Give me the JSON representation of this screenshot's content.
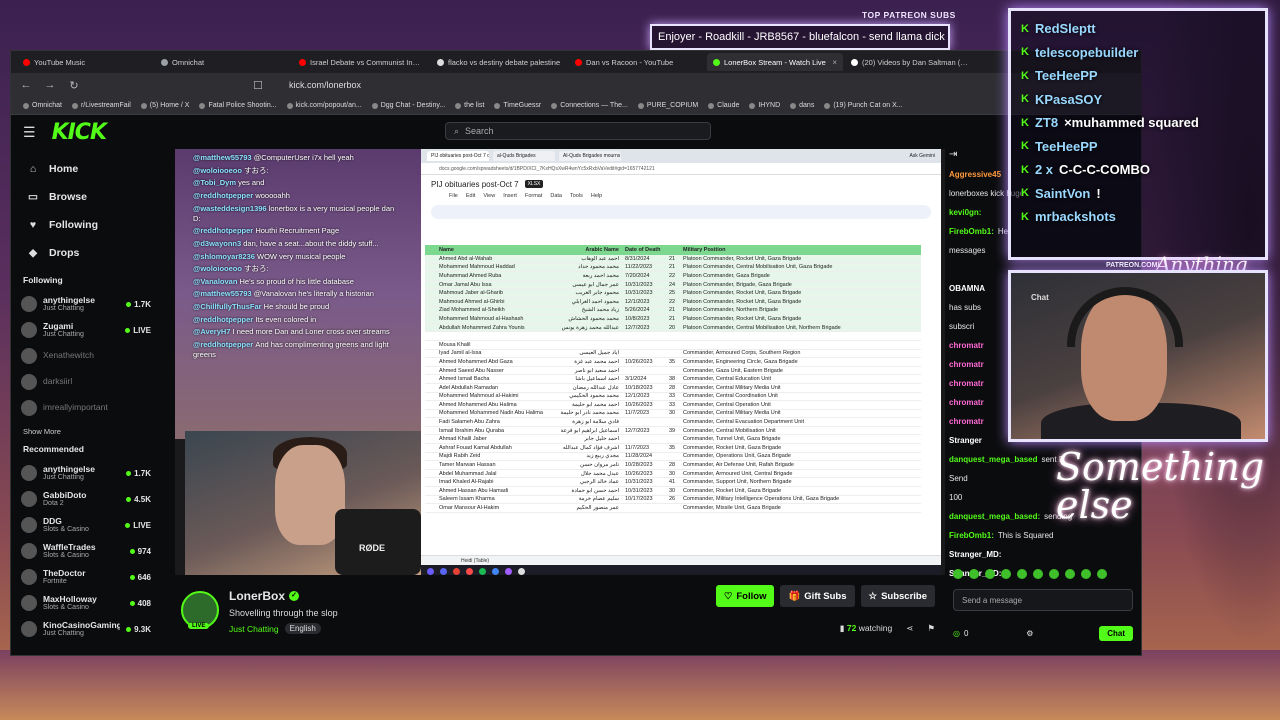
{
  "overlay": {
    "patreon_title": "TOP PATREON SUBS",
    "ticker": "Enjoyer - Roadkill - JRB8567 - bluefalcon - send llama dick",
    "patreon_url": "PATREON.COM/",
    "brand_script": "Something else",
    "brand_script_small": "Anything else",
    "subs": [
      {
        "name": "RedSleptt",
        "suffix": ""
      },
      {
        "name": "telescopebuilder",
        "suffix": ""
      },
      {
        "name": "TeeHeePP",
        "suffix": ""
      },
      {
        "name": "KPasaSOY",
        "suffix": ""
      },
      {
        "name": "ZT8",
        "suffix": "×muhammed squared"
      },
      {
        "name": "TeeHeePP",
        "suffix": ""
      },
      {
        "name": "2 x",
        "suffix": "C-C-C-COMBO"
      },
      {
        "name": "SaintVon",
        "suffix": "!"
      },
      {
        "name": "mrbackshots",
        "suffix": ""
      }
    ],
    "cam_label": "Chat"
  },
  "browser": {
    "tabs": [
      {
        "label": "YouTube Music",
        "color": "#ff0000",
        "active": false
      },
      {
        "label": "Omnichat",
        "color": "#9aa0a6",
        "active": false
      },
      {
        "label": "Israel Debate vs Communist Instant",
        "color": "#ff0000",
        "active": false
      },
      {
        "label": "flacko vs destiny debate palestine",
        "color": "#dddddd",
        "active": false
      },
      {
        "label": "Dan vs Racoon - YouTube",
        "color": "#ff0000",
        "active": false
      },
      {
        "label": "LonerBox Stream - Watch Live",
        "color": "#53fc18",
        "active": true
      },
      {
        "label": "(20) Videos by Dan Saltman (@dan",
        "color": "#ffffff",
        "active": false
      }
    ],
    "url": "kick.com/lonerbox",
    "bookmarks": [
      "Omnichat",
      "r/LivestreamFail",
      "(5) Home / X",
      "Fatal Police Shootin...",
      "kick.com/popout/an...",
      "Dgg Chat - Destiny...",
      "the list",
      "TimeGuessr",
      "Connections — The...",
      "PURE_COPIUM",
      "Claude",
      "IHYND",
      "dans",
      "(19) Punch Cat on X..."
    ]
  },
  "kick": {
    "search_placeholder": "Search",
    "nav": [
      {
        "label": "Home",
        "icon": "⌂"
      },
      {
        "label": "Browse",
        "icon": "▭"
      },
      {
        "label": "Following",
        "icon": "♥"
      },
      {
        "label": "Drops",
        "icon": "◆"
      }
    ],
    "following_header": "Following",
    "following": [
      {
        "name": "anythingelse",
        "cat": "Just Chatting",
        "viewers": "1.7K",
        "dim": false
      },
      {
        "name": "Zugami",
        "cat": "Just Chatting",
        "viewers": "LIVE",
        "dim": false
      },
      {
        "name": "Xenathewitch",
        "cat": "",
        "viewers": "",
        "dim": true
      },
      {
        "name": "darksiirl",
        "cat": "",
        "viewers": "",
        "dim": true
      },
      {
        "name": "imreallyimportant",
        "cat": "",
        "viewers": "",
        "dim": true
      }
    ],
    "show_more": "Show More",
    "recommended_header": "Recommended",
    "recommended": [
      {
        "name": "anythingelse",
        "cat": "Just Chatting",
        "viewers": "1.7K"
      },
      {
        "name": "GabbiDoto",
        "cat": "Dota 2",
        "viewers": "4.5K"
      },
      {
        "name": "DDG",
        "cat": "Slots & Casino",
        "viewers": "LIVE"
      },
      {
        "name": "WaffleTrades",
        "cat": "Slots & Casino",
        "viewers": "974"
      },
      {
        "name": "TheDoctor",
        "cat": "Fortnite",
        "viewers": "646"
      },
      {
        "name": "MaxHolloway",
        "cat": "Slots & Casino",
        "viewers": "408"
      },
      {
        "name": "KinoCasinoGaming",
        "cat": "Just Chatting",
        "viewers": "9.3K"
      }
    ],
    "streamer": {
      "name": "LonerBox",
      "live_badge": "LIVE",
      "title": "Shovelling through the slop",
      "category": "Just Chatting",
      "language": "English",
      "watching_count": "72",
      "watching_label": "watching"
    },
    "buttons": {
      "follow": "Follow",
      "gift": "Gift Subs",
      "subscribe": "Subscribe"
    },
    "chat_input_placeholder": "Send a message",
    "chat_button": "Chat",
    "chat_count": "0"
  },
  "stream_chat": [
    {
      "user": "@matthew55793",
      "text": "@ComputerUser i7x hell yeah"
    },
    {
      "user": "@woloiooeoo",
      "text": "すおろ:"
    },
    {
      "user": "@Tobi_Dym",
      "text": "yes and"
    },
    {
      "user": "@reddhotpepper",
      "text": "wooooahh"
    },
    {
      "user": "@wasteddesign1396",
      "text": "lonerbox is a very musical people dan D:"
    },
    {
      "user": "@reddhotpepper",
      "text": "Houthi Recruitment Page"
    },
    {
      "user": "@d3wayonn3",
      "text": "dan, have a seat...about the diddy stuff..."
    },
    {
      "user": "@shlomoyar8236",
      "text": "WOW very musical people"
    },
    {
      "user": "@woloiooeoo",
      "text": "すおろ:"
    },
    {
      "user": "@Vanalovan",
      "text": "He's so proud of his little database"
    },
    {
      "user": "@matthew55793",
      "text": "@Vanalovan he's literally a historian"
    },
    {
      "user": "@ChillfullyThusFar",
      "text": "He should be proud"
    },
    {
      "user": "@reddhotpepper",
      "text": "Its even colored in"
    },
    {
      "user": "@AveryH7",
      "text": "I need more Dan and Loner cross over streams"
    },
    {
      "user": "@reddhotpepper",
      "text": "And has complimenting greens and light greens"
    }
  ],
  "webcam_label": "RØDE",
  "sheet": {
    "tabs": [
      "PIJ obituaries post-Oct 7 obo",
      "al-Quds Brigades",
      "Al-Quds Brigades mourns a gr"
    ],
    "ask_label": "Ask Gemini",
    "url": "docs.google.com/spreadsheets/d/1BPD/XCI_7KxHQsXwR4wnYc5xRxbVaVedit#gid=1657742121",
    "title": "PIJ obituaries post-Oct 7",
    "badge": "XLSX",
    "menu": [
      "File",
      "Edit",
      "View",
      "Insert",
      "Format",
      "Data",
      "Tools",
      "Help"
    ],
    "headers": [
      "Name",
      "Arabic Name",
      "Date of Death",
      "",
      "Military Position"
    ],
    "rows": [
      {
        "name": "Ahmed Abd al-Wahab",
        "ar": "احمد عبد الوهاب",
        "date": "8/31/2024",
        "n": "21",
        "pos": "Platoon Commander, Rocket Unit, Gaza Brigade",
        "g": true
      },
      {
        "name": "Mohammed Mahmoud Haddad",
        "ar": "محمد محمود حداد",
        "date": "11/22/2023",
        "n": "21",
        "pos": "Platoon Commander, Central Mobilisation Unit, Gaza Brigade",
        "g": true
      },
      {
        "name": "Muhammad Ahmed Ruba",
        "ar": "محمد احمد ربعة",
        "date": "7/20/2024",
        "n": "22",
        "pos": "Platoon Commander, Gaza Brigade",
        "g": true
      },
      {
        "name": "Omar Jamal Abu Issa",
        "ar": "عمر جمال ابو عيسى",
        "date": "10/31/2023",
        "n": "24",
        "pos": "Platoon Commander, Brigade, Gaza Brigade",
        "g": true
      },
      {
        "name": "Mahmoud Jaber al-Gharib",
        "ar": "محمود جابر الغريب",
        "date": "10/31/2023",
        "n": "25",
        "pos": "Platoon Commander, Rocket Unit, Gaza Brigade",
        "g": true
      },
      {
        "name": "Mahmoud Ahmed al-Ghirbi",
        "ar": "محمود احمد الغرابلي",
        "date": "12/1/2023",
        "n": "22",
        "pos": "Platoon Commander, Rocket Unit, Gaza Brigade",
        "g": true
      },
      {
        "name": "Ziad Mohammed al-Sheikh",
        "ar": "زياد محمد الشيخ",
        "date": "5/26/2024",
        "n": "21",
        "pos": "Platoon Commander, Northern Brigade",
        "g": true
      },
      {
        "name": "Mohammed Mahmoud al-Hashash",
        "ar": "محمد محمود الحشاش",
        "date": "10/8/2023",
        "n": "21",
        "pos": "Platoon Commander, Rocket Unit, Gaza Brigade",
        "g": true
      },
      {
        "name": "Abdullah Mohammed Zahra Younis",
        "ar": "عبدالله محمد زهرة يونس",
        "date": "12/7/2023",
        "n": "20",
        "pos": "Platoon Commander, Central Mobilisation Unit, Northern Brigade",
        "g": true
      },
      {
        "name": "",
        "ar": "",
        "date": "",
        "n": "",
        "pos": "",
        "g": false
      },
      {
        "name": "Mousa Khalil",
        "ar": "",
        "date": "",
        "n": "",
        "pos": "",
        "g": false
      },
      {
        "name": "Iyad Jamil al-Issa",
        "ar": "اياد جميل العيسى",
        "date": "",
        "n": "",
        "pos": "Commander, Armoured Corps, Southern Region",
        "g": false
      },
      {
        "name": "Ahmed Mohammed Abd Gaza",
        "ar": "احمد محمد عبد غزة",
        "date": "10/26/2023",
        "n": "35",
        "pos": "Commander, Engineering Circle, Gaza Brigade",
        "g": false
      },
      {
        "name": "Ahmed Saeed Abu Nasser",
        "ar": "احمد سعيد ابو ناصر",
        "date": "",
        "n": "",
        "pos": "Commander, Gaza Unit, Eastern Brigade",
        "g": false
      },
      {
        "name": "Ahmed Ismail Bacha",
        "ar": "احمد اسماعيل باشا",
        "date": "3/1/2024",
        "n": "38",
        "pos": "Commander, Central Education Unit",
        "g": false
      },
      {
        "name": "Adel Abdullah Ramadan",
        "ar": "عادل عبدالله رمضان",
        "date": "10/18/2023",
        "n": "28",
        "pos": "Commander, Central Military Media Unit",
        "g": false
      },
      {
        "name": "Mohammed Mahmoud al-Hakimi",
        "ar": "محمد محمود الحكيمي",
        "date": "12/1/2023",
        "n": "33",
        "pos": "Commander, Central Coordination Unit",
        "g": false
      },
      {
        "name": "Ahmed Mohammed Abu Halima",
        "ar": "احمد محمد ابو حليمة",
        "date": "10/26/2023",
        "n": "33",
        "pos": "Commander, Central Operation Unit",
        "g": false
      },
      {
        "name": "Mohammed Mohammed Nadir Abu Halima",
        "ar": "محمد محمد نادر ابو حليمة",
        "date": "11/7/2023",
        "n": "30",
        "pos": "Commander, Central Military Media Unit",
        "g": false
      },
      {
        "name": "Fadi Salameh Abu Zahra",
        "ar": "فادي سلامة ابو زهرة",
        "date": "",
        "n": "",
        "pos": "Commander, Central Evacuation Department Unit",
        "g": false
      },
      {
        "name": "Ismail Ibrahim Abu Quraba",
        "ar": "اسماعيل ابراهيم ابو قرعة",
        "date": "12/7/2023",
        "n": "39",
        "pos": "Commander, Central Mobilisation Unit",
        "g": false
      },
      {
        "name": "Ahmad Khalil Jaber",
        "ar": "احمد خليل جابر",
        "date": "",
        "n": "",
        "pos": "Commander, Tunnel Unit, Gaza Brigade",
        "g": false
      },
      {
        "name": "Ashraf Fouad Kamal Abdullah",
        "ar": "اشرف فؤاد كمال عبدالله",
        "date": "11/7/2023",
        "n": "35",
        "pos": "Commander, Rocket Unit, Gaza Brigade",
        "g": false
      },
      {
        "name": "Majdi Rabih Zeid",
        "ar": "مجدي ربيع زيد",
        "date": "11/28/2024",
        "n": "",
        "pos": "Commander, Operations Unit, Gaza Brigade",
        "g": false
      },
      {
        "name": "Tamer Marwan Hassan",
        "ar": "تامر مروان حسن",
        "date": "10/28/2023",
        "n": "28",
        "pos": "Commander, Air Defense Unit, Rafah Brigade",
        "g": false
      },
      {
        "name": "Abdel Muhammad Jalal",
        "ar": "عبدل محمد جلال",
        "date": "10/26/2023",
        "n": "30",
        "pos": "Commander, Armoured Unit, Central Brigade",
        "g": false
      },
      {
        "name": "Imad Khaled Al-Rajabi",
        "ar": "عماد خالد الرجبي",
        "date": "10/31/2023",
        "n": "41",
        "pos": "Commander, Support Unit, Northern Brigade",
        "g": false
      },
      {
        "name": "Ahmed Hassan Abu Hamadi",
        "ar": "احمد حسن ابو حمادة",
        "date": "10/31/2023",
        "n": "30",
        "pos": "Commander, Rocket Unit, Gaza Brigade",
        "g": false
      },
      {
        "name": "Saleem Issam Kharma",
        "ar": "سليم عصام خرمة",
        "date": "10/17/2023",
        "n": "26",
        "pos": "Commander, Military Intelligence Operations Unit, Gaza Brigade",
        "g": false
      },
      {
        "name": "Omar Mansour Al-Hakim",
        "ar": "عمر منصور الحكيم",
        "date": "",
        "n": "",
        "pos": "Commander, Missile Unit, Gaza Brigade",
        "g": false
      }
    ],
    "bottom_tab": "Heidi (Table)"
  },
  "kick_chat": [
    {
      "user": "Aggressive45",
      "text": "",
      "color": "#ff9a3c"
    },
    {
      "user": "",
      "text": "lonerboxes kick huge",
      "color": "#fff"
    },
    {
      "user": "kevi0gn:",
      "text": "",
      "color": "#53fc18"
    },
    {
      "user": "FirebOmb1:",
      "text": "He",
      "color": "#53fc18"
    },
    {
      "user": "",
      "text": "messages",
      "color": "#fff"
    },
    {
      "user": "",
      "text": "",
      "color": "#fff"
    },
    {
      "user": "OBAMNA",
      "text": "",
      "color": "#fff"
    },
    {
      "user": "",
      "text": "has subs",
      "color": "#aaa"
    },
    {
      "user": "",
      "text": "subscri",
      "color": "#aaa"
    },
    {
      "user": "chromatr",
      "text": "",
      "color": "#ff6ad5"
    },
    {
      "user": "chromatr",
      "text": "",
      "color": "#ff6ad5"
    },
    {
      "user": "chromatr",
      "text": "",
      "color": "#ff6ad5"
    },
    {
      "user": "chromatr",
      "text": "",
      "color": "#ff6ad5"
    },
    {
      "user": "chromatr",
      "text": "",
      "color": "#ff6ad5"
    },
    {
      "user": "Stranger",
      "text": "",
      "color": "#fff"
    },
    {
      "user": "danquest_mega_based",
      "text": "sent F",
      "color": "#53fc18"
    },
    {
      "user": "",
      "text": "Send",
      "color": "#fff"
    },
    {
      "user": "",
      "text": "100",
      "color": "#fff"
    },
    {
      "user": "danquest_mega_based:",
      "text": "sending",
      "color": "#53fc18"
    },
    {
      "user": "FirebOmb1:",
      "text": "This is Squared",
      "color": "#53fc18"
    },
    {
      "user": "Stranger_MD:",
      "text": "",
      "color": "#fff"
    },
    {
      "user": "Stranger_MD:",
      "text": "",
      "color": "#fff"
    }
  ]
}
